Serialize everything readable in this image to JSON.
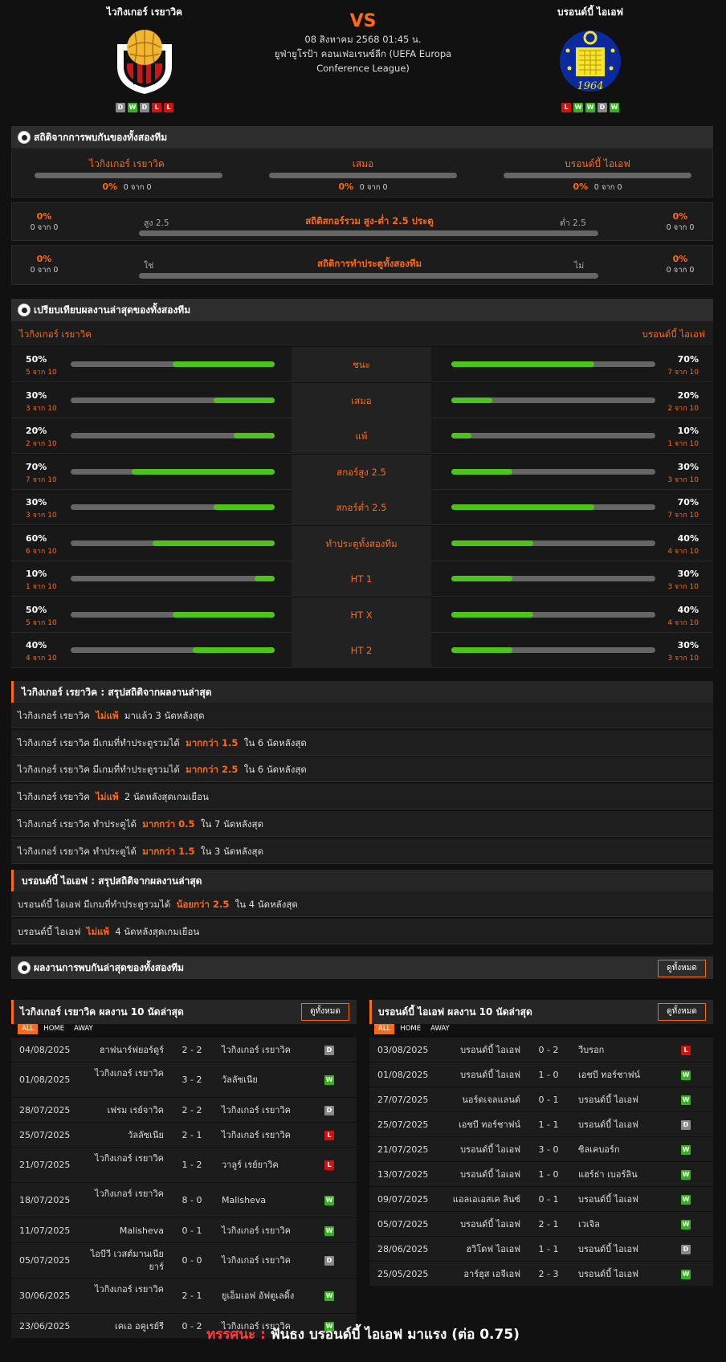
{
  "match": {
    "home": "ไวกิงเกอร์ เรยาวิค",
    "away": "บรอนด์บี้ ไอเอฟ",
    "vs": "VS",
    "date": "08 สิงหาคม 2568 01:45 น.",
    "league": "ยูฟ่ายูโรป้า คอนเฟอเรนซ์ลีก (UEFA Europa Conference League)",
    "home_form": [
      "D",
      "W",
      "D",
      "L",
      "L"
    ],
    "away_form": [
      "L",
      "W",
      "W",
      "D",
      "W"
    ],
    "away_logo_year": "1964"
  },
  "h2h_stats": {
    "title": "สถิติจากการพบกันของทั้งสองทีม",
    "home": {
      "label": "ไวกิงเกอร์ เรยาวิค",
      "pct": "0%",
      "sub": "0 จาก 0"
    },
    "draw": {
      "label": "เสมอ",
      "pct": "0%",
      "sub": "0 จาก 0"
    },
    "away": {
      "label": "บรอนด์บี้ ไอเอฟ",
      "pct": "0%",
      "sub": "0 จาก 0"
    }
  },
  "ou": {
    "title": "สถิติสกอร์รวม สูง-ต่ำ 2.5 ประตู",
    "left_label": "สูง 2.5",
    "right_label": "ต่ำ 2.5",
    "lpct": "0%",
    "lsub": "0 จาก 0",
    "rpct": "0%",
    "rsub": "0 จาก 0"
  },
  "btts": {
    "title": "สถิติการทำประตูทั้งสองทีม",
    "left_label": "ใช่",
    "right_label": "ไม่",
    "lpct": "0%",
    "lsub": "0 จาก 0",
    "rpct": "0%",
    "rsub": "0 จาก 0"
  },
  "compare": {
    "title": "เปรียบเทียบผลงานล่าสุดของทั้งสองทีม",
    "home": "ไวกิงเกอร์ เรยาวิค",
    "away": "บรอนด์บี้ ไอเอฟ",
    "rows": [
      {
        "label": "ชนะ",
        "lv": "50%",
        "ls": "5 จาก 10",
        "lf": 0.5,
        "rv": "70%",
        "rs": "7 จาก 10",
        "rf": 0.7
      },
      {
        "label": "เสมอ",
        "lv": "30%",
        "ls": "3 จาก 10",
        "lf": 0.3,
        "rv": "20%",
        "rs": "2 จาก 10",
        "rf": 0.2
      },
      {
        "label": "แพ้",
        "lv": "20%",
        "ls": "2 จาก 10",
        "lf": 0.2,
        "rv": "10%",
        "rs": "1 จาก 10",
        "rf": 0.1
      },
      {
        "label": "สกอร์สูง 2.5",
        "lv": "70%",
        "ls": "7 จาก 10",
        "lf": 0.7,
        "rv": "30%",
        "rs": "3 จาก 10",
        "rf": 0.3
      },
      {
        "label": "สกอร์ต่ำ 2.5",
        "lv": "30%",
        "ls": "3 จาก 10",
        "lf": 0.3,
        "rv": "70%",
        "rs": "7 จาก 10",
        "rf": 0.7
      },
      {
        "label": "ทำประตูทั้งสองทีม",
        "lv": "60%",
        "ls": "6 จาก 10",
        "lf": 0.6,
        "rv": "40%",
        "rs": "4 จาก 10",
        "rf": 0.4
      },
      {
        "label": "HT 1",
        "lv": "10%",
        "ls": "1 จาก 10",
        "lf": 0.1,
        "rv": "30%",
        "rs": "3 จาก 10",
        "rf": 0.3
      },
      {
        "label": "HT X",
        "lv": "50%",
        "ls": "5 จาก 10",
        "lf": 0.5,
        "rv": "40%",
        "rs": "4 จาก 10",
        "rf": 0.4
      },
      {
        "label": "HT 2",
        "lv": "40%",
        "ls": "4 จาก 10",
        "lf": 0.4,
        "rv": "30%",
        "rs": "3 จาก 10",
        "rf": 0.3
      }
    ]
  },
  "home_summary": {
    "title": "ไวกิงเกอร์ เรยาวิค : สรุปสถิติจากผลงานล่าสุด",
    "rows": [
      [
        "ไวกิงเกอร์ เรยาวิค",
        "ไม่แพ้",
        "มาแล้ว 3 นัดหลังสุด"
      ],
      [
        "ไวกิงเกอร์ เรยาวิค มีเกมที่ทำประตูรวมได้",
        "มากกว่า 1.5",
        "ใน 6 นัดหลังสุด"
      ],
      [
        "ไวกิงเกอร์ เรยาวิค มีเกมที่ทำประตูรวมได้",
        "มากกว่า 2.5",
        "ใน 6 นัดหลังสุด"
      ],
      [
        "ไวกิงเกอร์ เรยาวิค",
        "ไม่แพ้",
        "2 นัดหลังสุดเกมเยือน"
      ],
      [
        "ไวกิงเกอร์ เรยาวิค ทำประตูได้",
        "มากกว่า 0.5",
        "ใน 7 นัดหลังสุด"
      ],
      [
        "ไวกิงเกอร์ เรยาวิค ทำประตูได้",
        "มากกว่า 1.5",
        "ใน 3 นัดหลังสุด"
      ]
    ]
  },
  "away_summary": {
    "title": "บรอนด์บี้ ไอเอฟ : สรุปสถิติจากผลงานล่าสุด",
    "rows": [
      [
        "บรอนด์บี้ ไอเอฟ มีเกมที่ทำประตูรวมได้",
        "น้อยกว่า 2.5",
        "ใน 4 นัดหลังสุด"
      ],
      [
        "บรอนด์บี้ ไอเอฟ",
        "ไม่แพ้",
        "4 นัดหลังสุดเกมเยือน"
      ]
    ]
  },
  "h2h_results": {
    "title": "ผลงานการพบกันล่าสุดของทั้งสองทีม",
    "view_all": "ดูทั้งหมด"
  },
  "tabs": [
    "ALL",
    "HOME",
    "AWAY"
  ],
  "home_last10": {
    "title": "ไวกิงเกอร์ เรยาวิค ผลงาน 10 นัดล่าสุด",
    "view_all": "ดูทั้งหมด",
    "rows": [
      [
        "04/08/2025",
        "ฮาฟนาร์ฟยอร์ดูร์",
        "2 - 2",
        "ไวกิงเกอร์ เรยาวิค",
        "D"
      ],
      [
        "01/08/2025",
        "ไวกิงเกอร์ เรยาวิค",
        "3 - 2",
        "วัลลัซเนีย",
        "W"
      ],
      [
        "28/07/2025",
        "เฟรม เรย์จาวิค",
        "2 - 2",
        "ไวกิงเกอร์ เรยาวิค",
        "D"
      ],
      [
        "25/07/2025",
        "วัลลัซเนีย",
        "2 - 1",
        "ไวกิงเกอร์ เรยาวิค",
        "L"
      ],
      [
        "21/07/2025",
        "ไวกิงเกอร์ เรยาวิค",
        "1 - 2",
        "วาลูร์ เรย์ยาวิค",
        "L"
      ],
      [
        "18/07/2025",
        "ไวกิงเกอร์ เรยาวิค",
        "8 - 0",
        "Malisheva",
        "W"
      ],
      [
        "11/07/2025",
        "Malisheva",
        "0 - 1",
        "ไวกิงเกอร์ เรยาวิค",
        "W"
      ],
      [
        "05/07/2025",
        "ไอบีวี เวสต์มานเนียยาร์",
        "0 - 0",
        "ไวกิงเกอร์ เรยาวิค",
        "D"
      ],
      [
        "30/06/2025",
        "ไวกิงเกอร์ เรยาวิค",
        "2 - 1",
        "ยูเอ็มเอฟ อัฟตูเลดิ้ง",
        "W"
      ],
      [
        "23/06/2025",
        "เคเอ อคูเรย์รี",
        "0 - 2",
        "ไวกิงเกอร์ เรยาวิค",
        "W"
      ]
    ]
  },
  "away_last10": {
    "title": "บรอนด์บี้ ไอเอฟ ผลงาน 10 นัดล่าสุด",
    "view_all": "ดูทั้งหมด",
    "rows": [
      [
        "03/08/2025",
        "บรอนด์บี้ ไอเอฟ",
        "0 - 2",
        "วีบรอก",
        "L"
      ],
      [
        "01/08/2025",
        "บรอนด์บี้ ไอเอฟ",
        "1 - 0",
        "เอชบี ทอร์ชาฟน์",
        "W"
      ],
      [
        "27/07/2025",
        "นอร์ดเจลแลนด์",
        "0 - 1",
        "บรอนด์บี้ ไอเอฟ",
        "W"
      ],
      [
        "25/07/2025",
        "เอชบี ทอร์ชาฟน์",
        "1 - 1",
        "บรอนด์บี้ ไอเอฟ",
        "D"
      ],
      [
        "21/07/2025",
        "บรอนด์บี้ ไอเอฟ",
        "3 - 0",
        "ซิลเคบอร์ก",
        "W"
      ],
      [
        "13/07/2025",
        "บรอนด์บี้ ไอเอฟ",
        "1 - 0",
        "แฮร์ธ่า เบอร์ลิน",
        "W"
      ],
      [
        "09/07/2025",
        "แอลเอเอสเค ลินซ์",
        "0 - 1",
        "บรอนด์บี้ ไอเอฟ",
        "W"
      ],
      [
        "05/07/2025",
        "บรอนด์บี้ ไอเอฟ",
        "2 - 1",
        "เวเจิล",
        "W"
      ],
      [
        "28/06/2025",
        "ฮวิโดฟ ไอเอฟ",
        "1 - 1",
        "บรอนด์บี้ ไอเอฟ",
        "D"
      ],
      [
        "25/05/2025",
        "อาร์ฮุส เอจีเอฟ",
        "2 - 3",
        "บรอนด์บี้ ไอเอฟ",
        "W"
      ]
    ]
  },
  "verdict": {
    "key": "ทรรศนะ :",
    "text": "ฟันธง บรอนด์บี้ ไอเอฟ มาแรง (ต่อ 0.75)"
  },
  "colors": {
    "accent": "#ff6a13",
    "win": "#34b41a",
    "draw": "#888888",
    "loss": "#d21111",
    "bar_fill": "#4ec31b",
    "bar_track": "#666666"
  }
}
